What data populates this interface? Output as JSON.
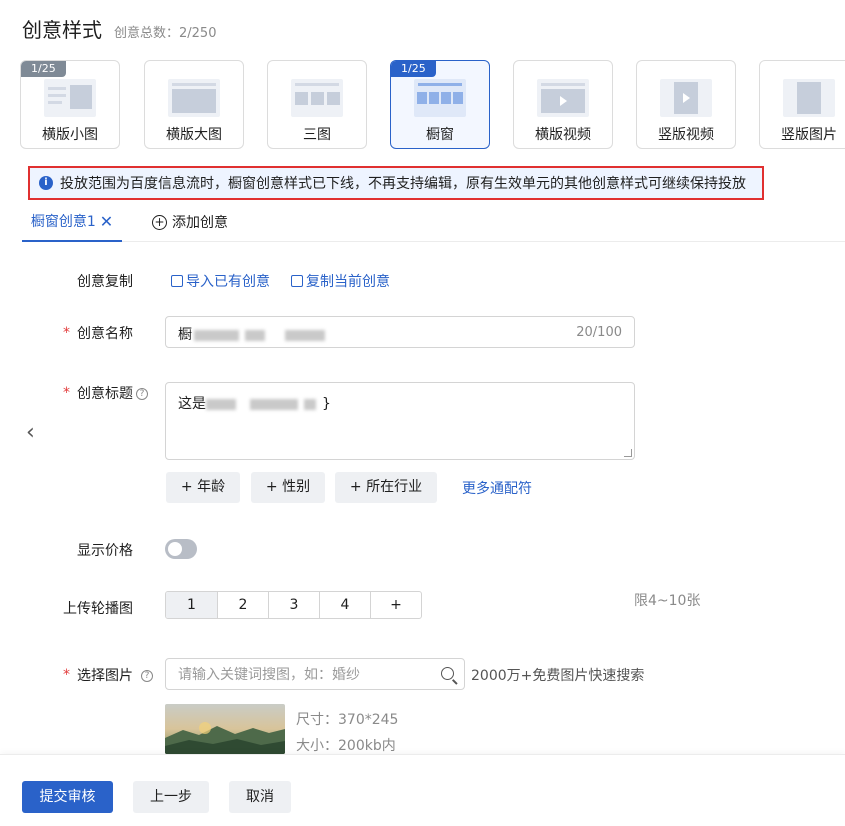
{
  "header": {
    "title": "创意样式",
    "count_text": "创意总数：2/250"
  },
  "style_cards": [
    {
      "label": "横版小图",
      "badge": "1/25",
      "active": false
    },
    {
      "label": "横版大图",
      "badge": "",
      "active": false
    },
    {
      "label": "三图",
      "badge": "",
      "active": false
    },
    {
      "label": "橱窗",
      "badge": "1/25",
      "active": true
    },
    {
      "label": "横版视频",
      "badge": "",
      "active": false
    },
    {
      "label": "竖版视频",
      "badge": "",
      "active": false
    },
    {
      "label": "竖版图片",
      "badge": "",
      "active": false
    }
  ],
  "alert": {
    "icon": "info-icon",
    "text": "投放范围为百度信息流时，橱窗创意样式已下线，不再支持编辑，原有生效单元的其他创意样式可继续保持投放",
    "border_color": "#e03030"
  },
  "tabs": {
    "active_label": "橱窗创意1",
    "add_label": "添加创意"
  },
  "form": {
    "copy": {
      "label": "创意复制",
      "import_link": "导入已有创意",
      "copy_link": "复制当前创意"
    },
    "name": {
      "label": "创意名称",
      "required": "*",
      "value_prefix": "橱",
      "counter": "20/100"
    },
    "title": {
      "label": "创意标题",
      "required": "*",
      "value_prefix": "这是",
      "value_suffix": "}"
    },
    "wildcards": [
      "+ 年龄",
      "+ 性别",
      "+ 所在行业"
    ],
    "more_wildcards": "更多通配符",
    "show_price": {
      "label": "显示价格",
      "enabled": false
    },
    "carousel": {
      "label": "上传轮播图",
      "options": [
        "1",
        "2",
        "3",
        "4",
        "+"
      ],
      "selected": "1",
      "hint": "限4~10张"
    },
    "image": {
      "label": "选择图片",
      "required": "*",
      "placeholder": "请输入关键词搜图，如：婚纱",
      "search_tip": "2000万+免费图片快速搜索",
      "size_text": "尺寸：370*245",
      "filesize_text": "大小：200kb内"
    }
  },
  "footer": {
    "submit": "提交审核",
    "prev": "上一步",
    "cancel": "取消"
  },
  "colors": {
    "primary": "#2a62c9",
    "required": "#e23b3b",
    "alert_bg": "#eef4ff"
  }
}
